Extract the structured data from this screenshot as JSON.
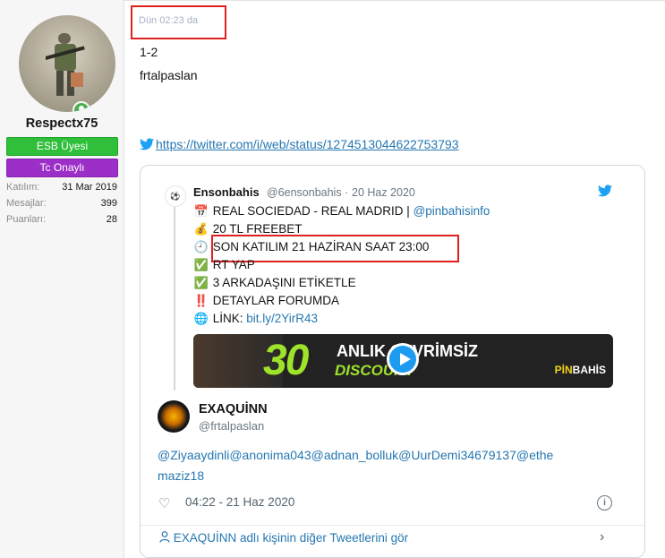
{
  "post": {
    "time": "Dün 02:23 da",
    "line1": "1-2",
    "line2": "frtalpaslan",
    "tweet_url": "https://twitter.com/i/web/status/1274513044622753793"
  },
  "user": {
    "name": "Respectx75",
    "badge1": "ESB Üyesi",
    "badge2": "Tc Onaylı",
    "stats": [
      {
        "label": "Katılım:",
        "value": "31 Mar 2019"
      },
      {
        "label": "Mesajlar:",
        "value": "399"
      },
      {
        "label": "Puanları:",
        "value": "28"
      }
    ]
  },
  "quoted": {
    "name": "Ensonbahis",
    "handle": "@6ensonbahis",
    "sep": "·",
    "date": "20 Haz 2020",
    "lines": [
      {
        "icon": "📅",
        "text": "REAL SOCIEDAD - REAL MADRID | ",
        "link": "@pinbahisinfo"
      },
      {
        "icon": "💰",
        "text": "20 TL FREEBET",
        "link": ""
      },
      {
        "icon": "🕘",
        "text": "SON KATILIM 21 HAZİRAN SAAT 23:00",
        "link": ""
      },
      {
        "icon": "✅",
        "text": "RT YAP",
        "link": ""
      },
      {
        "icon": "✅",
        "text": "3 ARKADAŞINI ETİKETLE",
        "link": ""
      },
      {
        "icon": "‼️",
        "text": "DETAYLAR FORUMDA",
        "link": ""
      },
      {
        "icon": "🌐",
        "text": "LİNK: ",
        "link": "bit.ly/2YirR43"
      }
    ],
    "media": {
      "num": "30",
      "t1": "ANLIK ÇEVRİMSİZ",
      "t2": "DISCOUNT",
      "brand_a": "PİN",
      "brand_b": "BAHİS"
    }
  },
  "tweet": {
    "author": "EXAQUİNN",
    "handle": "@frtalpaslan",
    "mentions_line1": "@Ziyaaydinli@anonima043@adnan_bolluk@UurDemi34679137@ethe",
    "mentions_line2": "maziz18",
    "datetime": "04:22 - 21 Haz 2020",
    "more": "EXAQUİNN adlı kişinin diğer Tweetlerini gör",
    "info_icon": "i"
  },
  "colors": {
    "highlight": "#e01f1f",
    "link": "#2577b1",
    "badge_green": "#2fbf3a",
    "badge_purple": "#9b2fc7"
  }
}
